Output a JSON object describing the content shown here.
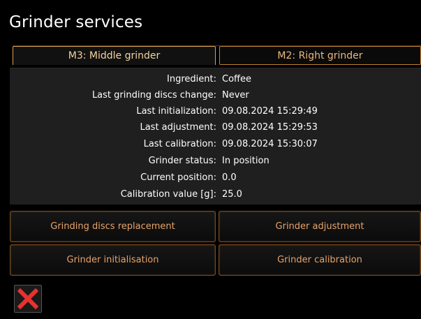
{
  "title": "Grinder services",
  "tabs": [
    {
      "label": "M3: Middle grinder",
      "active": true
    },
    {
      "label": "M2: Right grinder",
      "active": false
    }
  ],
  "info": [
    {
      "label": "Ingredient:",
      "value": "Coffee"
    },
    {
      "label": "Last grinding discs change:",
      "value": "Never"
    },
    {
      "label": "Last initialization:",
      "value": "09.08.2024 15:29:49"
    },
    {
      "label": "Last adjustment:",
      "value": "09.08.2024 15:29:53"
    },
    {
      "label": "Last calibration:",
      "value": "09.08.2024 15:30:07"
    },
    {
      "label": "Grinder status:",
      "value": "In position"
    },
    {
      "label": "Current position:",
      "value": "0.0"
    },
    {
      "label": "Calibration value [g]:",
      "value": "25.0"
    }
  ],
  "buttons": {
    "discs_replacement": "Grinding discs replacement",
    "adjustment": "Grinder adjustment",
    "initialisation": "Grinder initialisation",
    "calibration": "Grinder calibration"
  },
  "close": {
    "icon": "close-x-icon",
    "color": "#e8322f"
  },
  "colors": {
    "background": "#000000",
    "panel": "#1f1f1f",
    "accent": "#e0a050",
    "button_text": "#e8a36a"
  }
}
